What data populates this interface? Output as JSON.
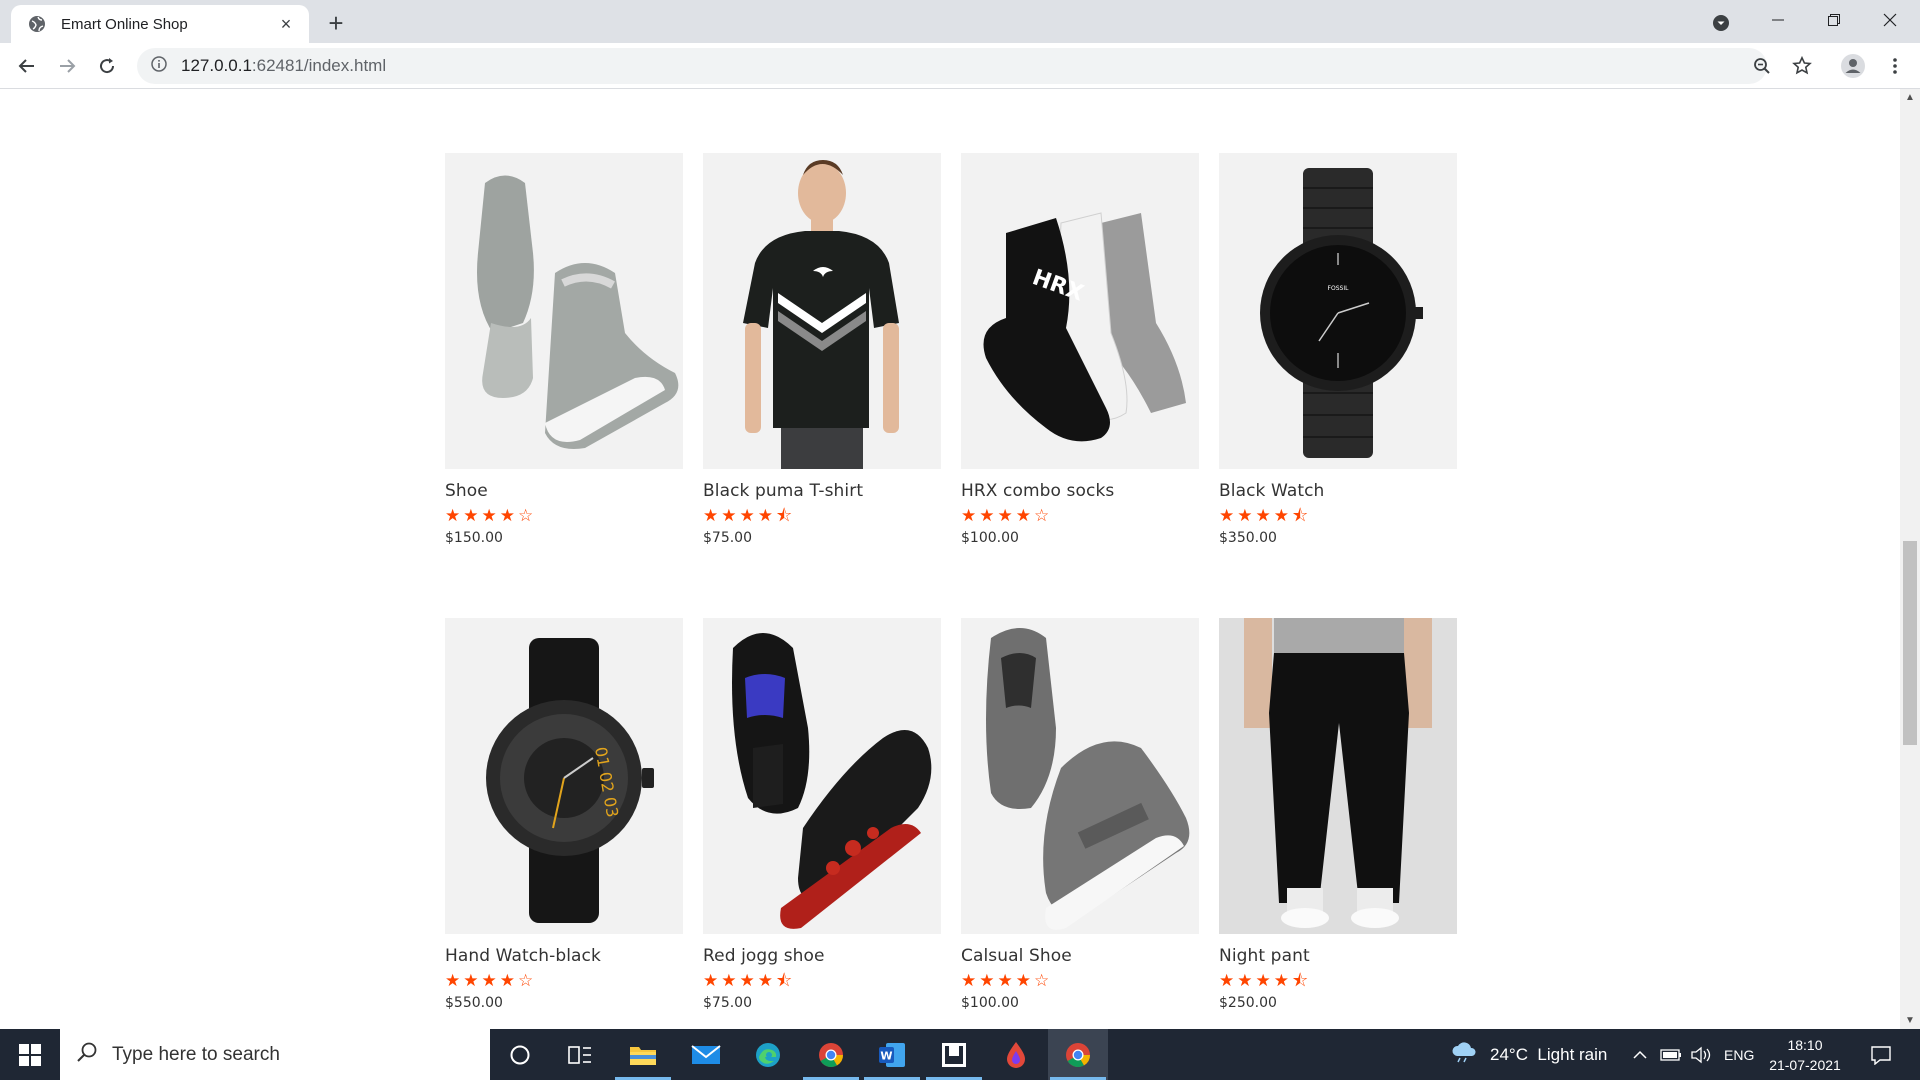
{
  "browser": {
    "tab_title": "Emart Online Shop",
    "tab_close": "×",
    "new_tab": "+",
    "url_host": "127.0.0.1",
    "url_rest": ":62481/index.html"
  },
  "products": [
    {
      "name": "Shoe",
      "rating": 4,
      "price": "$150.00",
      "image": "grey-sneaker"
    },
    {
      "name": "Black puma T-shirt",
      "rating": 4.5,
      "price": "$75.00",
      "image": "black-tshirt"
    },
    {
      "name": "HRX combo socks",
      "rating": 4,
      "price": "$100.00",
      "image": "socks"
    },
    {
      "name": "Black Watch",
      "rating": 4.5,
      "price": "$350.00",
      "image": "black-watch"
    },
    {
      "name": "Hand Watch-black",
      "rating": 4,
      "price": "$550.00",
      "image": "leather-watch"
    },
    {
      "name": "Red jogg shoe",
      "rating": 4.5,
      "price": "$75.00",
      "image": "red-jogg-shoe"
    },
    {
      "name": "Calsual Shoe",
      "rating": 4,
      "price": "$100.00",
      "image": "casual-shoe"
    },
    {
      "name": "Night pant",
      "rating": 4.5,
      "price": "$250.00",
      "image": "night-pant"
    }
  ],
  "colors": {
    "star": "#ff4500",
    "accent": "#76b9ed"
  },
  "taskbar": {
    "search_placeholder": "Type here to search",
    "weather": "24°C  Light rain",
    "language": "ENG",
    "time": "18:10",
    "date": "21-07-2021"
  }
}
